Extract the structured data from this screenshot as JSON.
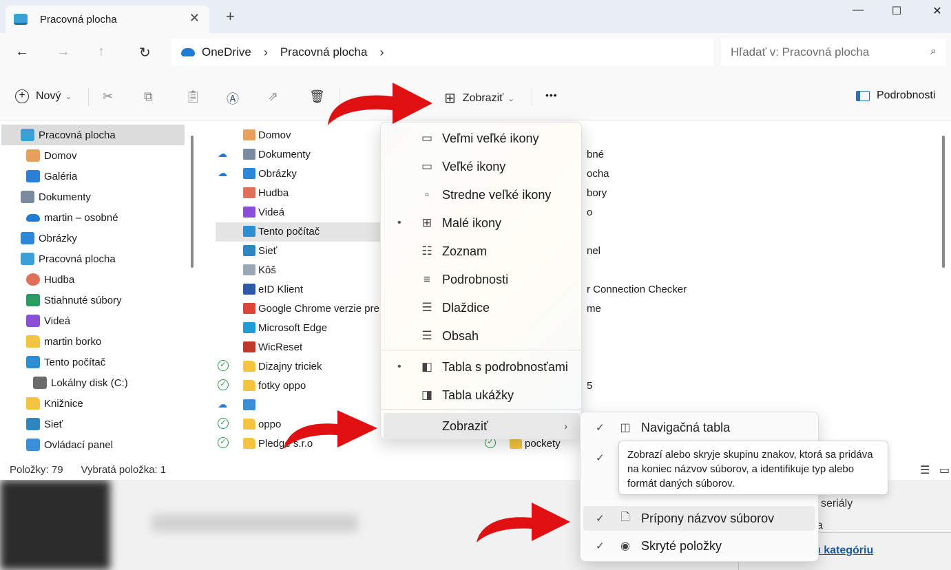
{
  "window": {
    "tab_title": "Pracovná plocha",
    "tab_close": "✕",
    "new_tab": "+",
    "minimize": "—",
    "maximize": "☐",
    "close": "✕"
  },
  "address": {
    "back": "←",
    "forward": "→",
    "up": "↑",
    "refresh": "↻",
    "crumbs": [
      "OneDrive",
      "Pracovná plocha"
    ],
    "sep": "›",
    "search_placeholder": "Hľadať v: Pracovná plocha",
    "search_icon": "⌕"
  },
  "command_bar": {
    "new_label": "Nový",
    "view_label": "Zobraziť",
    "more": "•••",
    "details_label": "Podrobnosti",
    "chevron": "⌄"
  },
  "nav_pane": {
    "items": [
      {
        "label": "Pracovná plocha",
        "icon": "desktop-icon",
        "color": "#3aa0d8"
      },
      {
        "label": "Domov",
        "icon": "home-icon",
        "color": "#e8a05b"
      },
      {
        "label": "Galéria",
        "icon": "gallery-icon",
        "color": "#2d7fd1"
      },
      {
        "label": "Dokumenty",
        "icon": "documents-icon",
        "color": "#7a8ba0"
      },
      {
        "label": "martin – osobné",
        "icon": "onedrive-icon",
        "color": "#1f7bd4"
      },
      {
        "label": "Obrázky",
        "icon": "pictures-icon",
        "color": "#2b87d8"
      },
      {
        "label": "Pracovná plocha",
        "icon": "desktop-icon",
        "color": "#3aa0d8"
      },
      {
        "label": "Hudba",
        "icon": "music-icon",
        "color": "#e0705a"
      },
      {
        "label": "Stiahnuté súbory",
        "icon": "downloads-icon",
        "color": "#2a9d62"
      },
      {
        "label": "Videá",
        "icon": "videos-icon",
        "color": "#8a4fd6"
      },
      {
        "label": "martin borko",
        "icon": "folder-icon",
        "color": "#f5c542"
      },
      {
        "label": "Tento počítač",
        "icon": "computer-icon",
        "color": "#2b8fd0"
      },
      {
        "label": "Lokálny disk (C:)",
        "icon": "drive-icon",
        "color": "#6b6b6b"
      },
      {
        "label": "Knižnice",
        "icon": "folder-icon",
        "color": "#f5c542"
      },
      {
        "label": "Sieť",
        "icon": "network-icon",
        "color": "#2e86c1"
      },
      {
        "label": "Ovládací panel",
        "icon": "control-panel-icon",
        "color": "#3b8fd6"
      }
    ]
  },
  "file_list": {
    "left_items": [
      {
        "label": "Domov",
        "icon": "home-icon",
        "color": "#e8a05b",
        "status": ""
      },
      {
        "label": "Dokumenty",
        "icon": "documents-icon",
        "color": "#7a8ba0",
        "status": "cloud"
      },
      {
        "label": "Obrázky",
        "icon": "pictures-icon",
        "color": "#2b87d8",
        "status": "cloud"
      },
      {
        "label": "Hudba",
        "icon": "music-icon",
        "color": "#e0705a",
        "status": ""
      },
      {
        "label": "Videá",
        "icon": "videos-icon",
        "color": "#8a4fd6",
        "status": ""
      },
      {
        "label": "Tento počítač",
        "icon": "computer-icon",
        "color": "#2b8fd0",
        "status": ""
      },
      {
        "label": "Sieť",
        "icon": "network-icon",
        "color": "#2e86c1",
        "status": ""
      },
      {
        "label": "Kôš",
        "icon": "recycle-bin-icon",
        "color": "#9aa7b5",
        "status": ""
      },
      {
        "label": "eID Klient",
        "icon": "shortcut-icon",
        "color": "#2a5caa",
        "status": ""
      },
      {
        "label": "Google Chrome verzie pre",
        "icon": "chrome-icon",
        "color": "#db4437",
        "status": ""
      },
      {
        "label": "Microsoft Edge",
        "icon": "edge-icon",
        "color": "#1f9bd6",
        "status": ""
      },
      {
        "label": "WicReset",
        "icon": "shortcut-icon",
        "color": "#c0392b",
        "status": ""
      },
      {
        "label": "Dizajny triciek",
        "icon": "folder-icon",
        "color": "#f5c542",
        "status": "synced"
      },
      {
        "label": "fotky oppo",
        "icon": "folder-icon",
        "color": "#f5c542",
        "status": "synced"
      },
      {
        "label": "",
        "icon": "image-file-icon",
        "color": "#3b8fd6",
        "status": "cloud"
      },
      {
        "label": "oppo",
        "icon": "folder-icon",
        "color": "#f5c542",
        "status": "synced"
      },
      {
        "label": "Pledge s.r.o",
        "icon": "folder-icon",
        "color": "#f5c542",
        "status": "synced"
      }
    ],
    "right_partials": [
      {
        "label": "bné",
        "row": 1
      },
      {
        "label": "ocha",
        "row": 2
      },
      {
        "label": "bory",
        "row": 3
      },
      {
        "label": "o",
        "row": 4
      },
      {
        "label": "nel",
        "row": 6
      },
      {
        "label": "r Connection Checker",
        "row": 8
      },
      {
        "label": "me",
        "row": 9
      },
      {
        "label": "5",
        "row": 13
      }
    ],
    "pockety": {
      "label": "pockety",
      "status": "synced"
    }
  },
  "status_bar": {
    "items_count": "Položky: 79",
    "selected": "Vybratá položka: 1"
  },
  "view_menu": {
    "items": [
      {
        "label": "Veľmi veľké ikony",
        "icon": "xl-icons-icon",
        "glyph": "▭",
        "bullet": ""
      },
      {
        "label": "Veľké ikony",
        "icon": "large-icons-icon",
        "glyph": "▭",
        "bullet": ""
      },
      {
        "label": "Stredne veľké ikony",
        "icon": "medium-icons-icon",
        "glyph": "▫",
        "bullet": ""
      },
      {
        "label": "Malé ikony",
        "icon": "small-icons-icon",
        "glyph": "⊞",
        "bullet": "•"
      },
      {
        "label": "Zoznam",
        "icon": "list-icon",
        "glyph": "☷",
        "bullet": ""
      },
      {
        "label": "Podrobnosti",
        "icon": "details-icon",
        "glyph": "≡",
        "bullet": ""
      },
      {
        "label": "Dlaždice",
        "icon": "tiles-icon",
        "glyph": "☰",
        "bullet": ""
      },
      {
        "label": "Obsah",
        "icon": "content-icon",
        "glyph": "☰",
        "bullet": ""
      },
      {
        "label": "Tabla s podrobnosťami",
        "icon": "details-pane-icon",
        "glyph": "◧",
        "bullet": "•"
      },
      {
        "label": "Tabla ukážky",
        "icon": "preview-pane-icon",
        "glyph": "◨",
        "bullet": ""
      },
      {
        "label": "Zobraziť",
        "icon": "",
        "glyph": "",
        "bullet": "",
        "arrow": "›"
      }
    ]
  },
  "show_submenu": {
    "items": [
      {
        "label": "Navigačná tabla",
        "icon": "navigation-pane-icon",
        "glyph": "◫",
        "check": "✓"
      },
      {
        "label": "",
        "icon": "compact-view-icon",
        "glyph": "⤡",
        "check": "✓"
      },
      {
        "label": "",
        "icon": "checkbox-icon",
        "glyph": "☐",
        "check": ""
      },
      {
        "label": "Prípony názvov súborov",
        "icon": "file-extensions-icon",
        "glyph": "🗋",
        "check": "✓"
      },
      {
        "label": "Skryté položky",
        "icon": "hidden-items-icon",
        "glyph": "◉",
        "check": "✓"
      }
    ]
  },
  "tooltip": {
    "text": "Zobrazí alebo skryje skupinu znakov, ktorá sa pridáva na koniec názvov súborov, a identifikuje typ alebo formát daných súborov."
  },
  "background_text": {
    "serialy": "seriály",
    "a": "a",
    "link": "ú kategóriu"
  },
  "colors": {
    "annotation_arrow": "#e01010",
    "accent": "#0067c0",
    "synced": "#2a9d4a",
    "cloud": "#1f7bd4"
  }
}
